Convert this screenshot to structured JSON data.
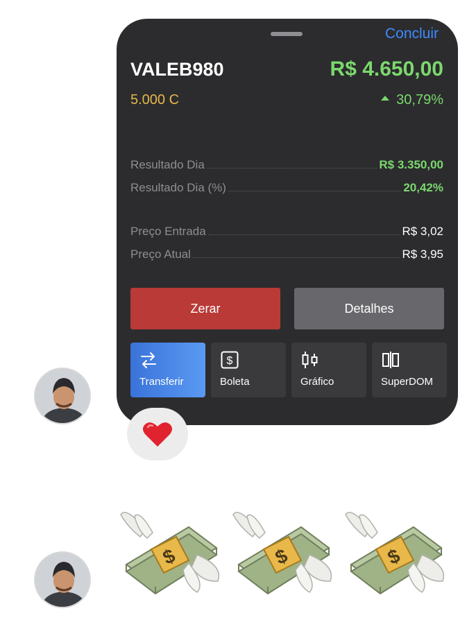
{
  "card": {
    "done_label": "Concluir",
    "ticker": "VALEB980",
    "price": "R$ 4.650,00",
    "quantity": "5.000 C",
    "change": "30,79%",
    "rows": [
      {
        "label": "Resultado Dia",
        "value": "R$ 3.350,00"
      },
      {
        "label": "Resultado Dia (%)",
        "value": "20,42%"
      },
      {
        "label": "Preço Entrada",
        "value": "R$ 3,02"
      },
      {
        "label": "Preço Atual",
        "value": "R$ 3,95"
      }
    ],
    "buttons": {
      "zero": "Zerar",
      "details": "Detalhes"
    },
    "tools": [
      {
        "label": "Transferir",
        "icon": "transfer-arrows-icon",
        "active": true
      },
      {
        "label": "Boleta",
        "icon": "dollar-box-icon",
        "active": false
      },
      {
        "label": "Gráfico",
        "icon": "candlestick-chart-icon",
        "active": false
      },
      {
        "label": "SuperDOM",
        "icon": "superdom-bars-icon",
        "active": false
      }
    ]
  },
  "reaction": {
    "emoji": "heart-icon"
  },
  "stickers": [
    "money-with-wings-icon",
    "money-with-wings-icon",
    "money-with-wings-icon"
  ],
  "colors": {
    "card_bg": "#2c2c2e",
    "positive": "#7bd86e",
    "quantity": "#e7b84a",
    "link": "#3d8bfd",
    "danger": "#b93a36",
    "neutral_button": "#68686c",
    "active_tool": "#4a86e8"
  }
}
